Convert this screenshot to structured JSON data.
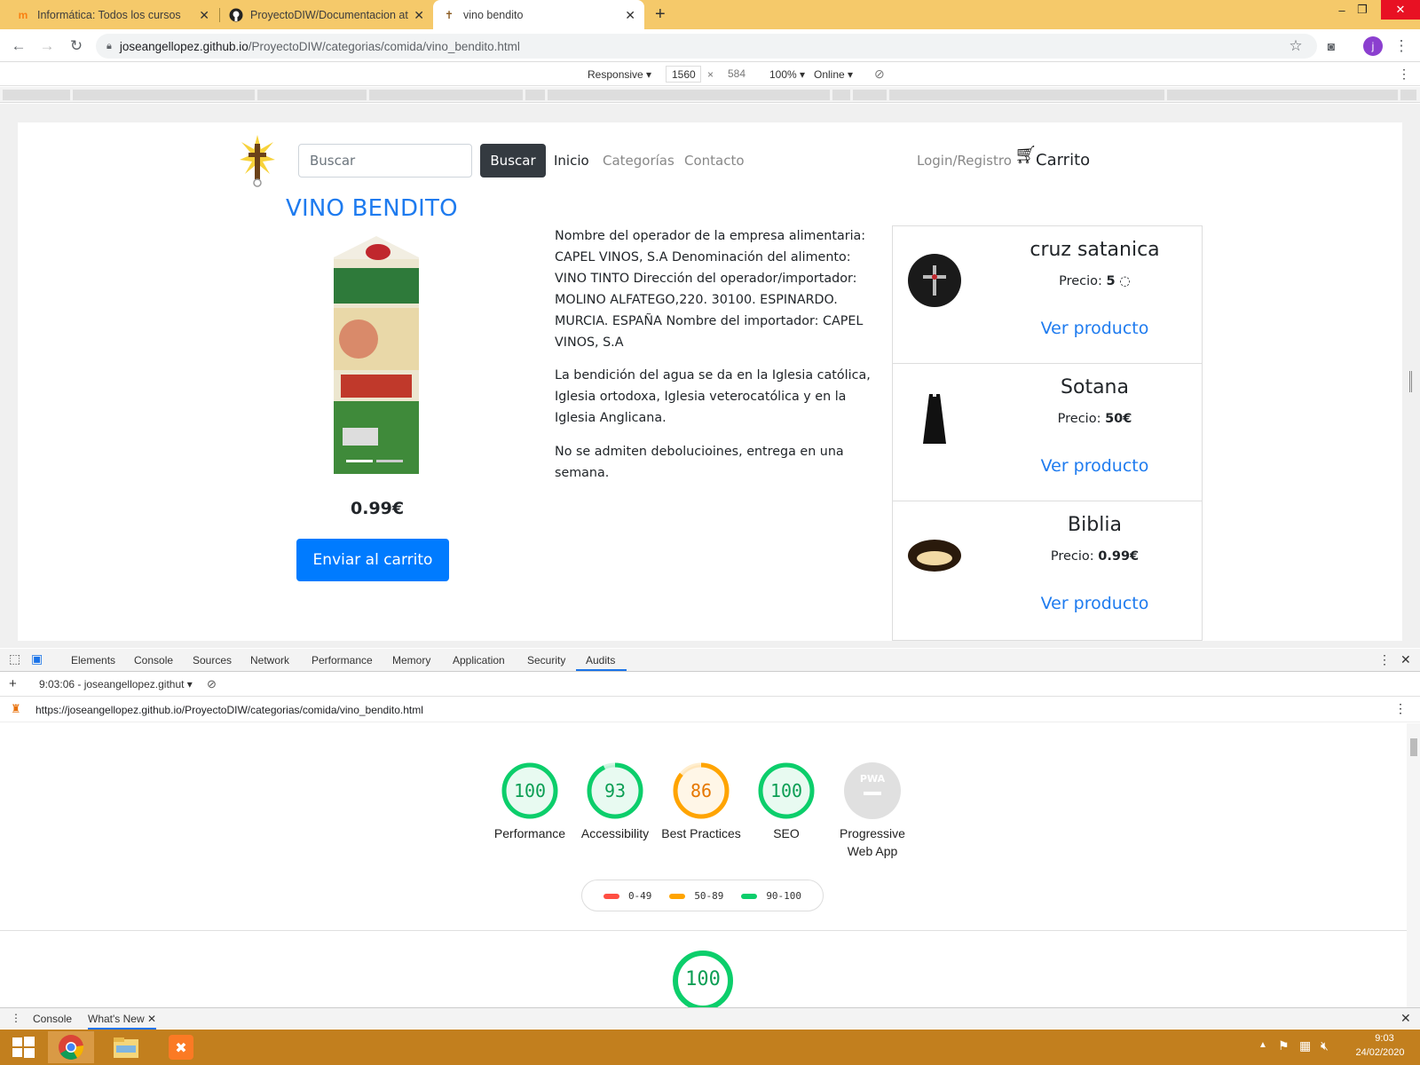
{
  "browser": {
    "tabs": [
      {
        "title": "Informática: Todos los cursos",
        "icon": "moodle-icon"
      },
      {
        "title": "ProyectoDIW/Documentacion at",
        "icon": "github-icon"
      },
      {
        "title": "vino bendito",
        "icon": "cross-icon"
      }
    ],
    "url_host": "joseangellopez.github.io",
    "url_path": "/ProyectoDIW/categorias/comida/vino_bendito.html",
    "profile_initial": "j"
  },
  "device_toolbar": {
    "mode": "Responsive",
    "width": "1560",
    "height": "584",
    "zoom": "100%",
    "throttle": "Online"
  },
  "site": {
    "search_placeholder": "Buscar",
    "search_button": "Buscar",
    "nav": [
      "Inicio",
      "Categorías",
      "Contacto"
    ],
    "login": "Login/Registro",
    "cart": "Carrito",
    "product": {
      "title": "VINO BENDITO",
      "price": "0.99€",
      "add_to_cart": "Enviar al carrito",
      "desc1": "Nombre del operador de la empresa alimentaria: CAPEL VINOS, S.A Denominación del alimento: VINO TINTO Dirección del operador/importador: MOLINO ALFATEGO,220. 30100. ESPINARDO. MURCIA. ESPAÑA Nombre del importador: CAPEL VINOS, S.A",
      "desc2": "La bendición del agua se da en la Iglesia católica, Iglesia ortodoxa, Iglesia veterocatólica y en la Iglesia Anglicana.",
      "desc3": "No se admiten debolucioines, entrega en una semana."
    },
    "related": [
      {
        "name": "cruz satanica",
        "price_label": "Precio:",
        "price": "5",
        "link": "Ver producto"
      },
      {
        "name": "Sotana",
        "price_label": "Precio:",
        "price": "50€",
        "link": "Ver producto"
      },
      {
        "name": "Biblia",
        "price_label": "Precio:",
        "price": "0.99€",
        "link": "Ver producto"
      }
    ]
  },
  "devtools": {
    "tabs": [
      "Elements",
      "Console",
      "Sources",
      "Network",
      "Performance",
      "Memory",
      "Application",
      "Security",
      "Audits"
    ],
    "active_tab": "Audits",
    "report_select": "9:03:06 - joseangellopez.githut",
    "report_url": "https://joseangellopez.github.io/ProyectoDIW/categorias/comida/vino_bendito.html",
    "scores": [
      {
        "label": "Performance",
        "value": 100,
        "color": "#0cce6b"
      },
      {
        "label": "Accessibility",
        "value": 93,
        "color": "#0cce6b"
      },
      {
        "label": "Best Practices",
        "value": 86,
        "color": "#ffa400"
      },
      {
        "label": "SEO",
        "value": 100,
        "color": "#0cce6b"
      },
      {
        "label": "Progressive Web App",
        "value": null,
        "badge": "PWA",
        "color": "#e0e0e0"
      }
    ],
    "legend": [
      {
        "range": "0-49",
        "color": "#ff4e42"
      },
      {
        "range": "50-89",
        "color": "#ffa400"
      },
      {
        "range": "90-100",
        "color": "#0cce6b"
      }
    ],
    "section_score": "100",
    "drawer_tabs": [
      "Console",
      "What's New"
    ]
  },
  "taskbar": {
    "time": "9:03",
    "date": "24/02/2020"
  }
}
